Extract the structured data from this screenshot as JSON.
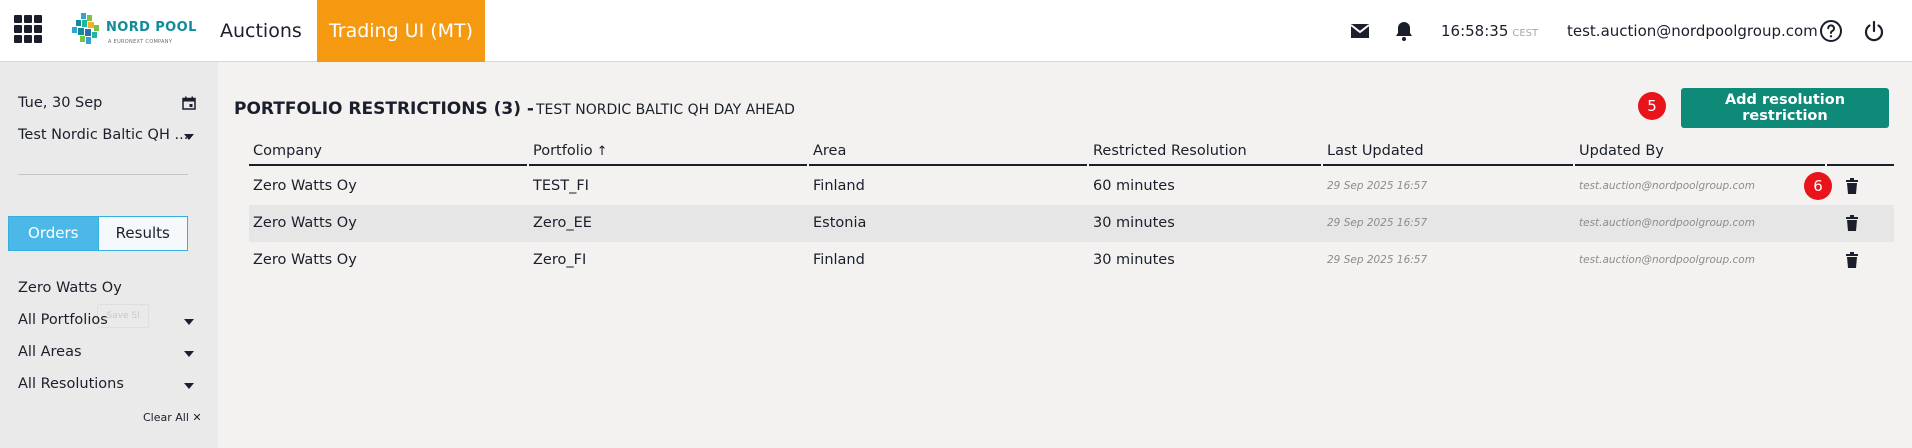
{
  "topbar": {
    "logo_text": "NORD POOL",
    "logo_sub": "A EURONEXT COMPANY",
    "nav": {
      "auctions": "Auctions",
      "trading": "Trading UI (MT)"
    },
    "clock": {
      "time": "16:58:35",
      "tz": "CEST"
    },
    "user_email": "test.auction@nordpoolgroup.com",
    "icons": [
      "apps-grid-icon",
      "mail-icon",
      "bell-icon",
      "help-icon",
      "power-icon"
    ]
  },
  "sidebar": {
    "date": "Tue, 30 Sep",
    "area_group": "Test Nordic Baltic QH ...",
    "tabs": {
      "orders": "Orders",
      "results": "Results"
    },
    "company": "Zero Watts Oy",
    "ghost_button": "Save Sl",
    "filters": {
      "portfolios": "All Portfolios",
      "areas": "All Areas",
      "resolutions": "All Resolutions"
    },
    "clear_all": "Clear All ✕"
  },
  "main": {
    "title": "PORTFOLIO RESTRICTIONS (3) -",
    "subtitle": "TEST NORDIC BALTIC QH DAY AHEAD",
    "add_button": "Add resolution restriction",
    "badge_add": "5",
    "badge_row": "6",
    "columns": [
      "Company",
      "Portfolio",
      "Area",
      "Restricted Resolution",
      "Last Updated",
      "Updated By"
    ],
    "sort_indicator": "↑",
    "rows": [
      {
        "company": "Zero Watts Oy",
        "portfolio": "TEST_FI",
        "area": "Finland",
        "resolution": "60 minutes",
        "updated": "29 Sep 2025 16:57",
        "by": "test.auction@nordpoolgroup.com"
      },
      {
        "company": "Zero Watts Oy",
        "portfolio": "Zero_EE",
        "area": "Estonia",
        "resolution": "30 minutes",
        "updated": "29 Sep 2025 16:57",
        "by": "test.auction@nordpoolgroup.com"
      },
      {
        "company": "Zero Watts Oy",
        "portfolio": "Zero_FI",
        "area": "Finland",
        "resolution": "30 minutes",
        "updated": "29 Sep 2025 16:57",
        "by": "test.auction@nordpoolgroup.com"
      }
    ]
  },
  "colors": {
    "accent_orange": "#f59a10",
    "teal_button": "#0f8a78",
    "toggle_blue": "#4cb8e8",
    "badge_red": "#e8141a"
  }
}
